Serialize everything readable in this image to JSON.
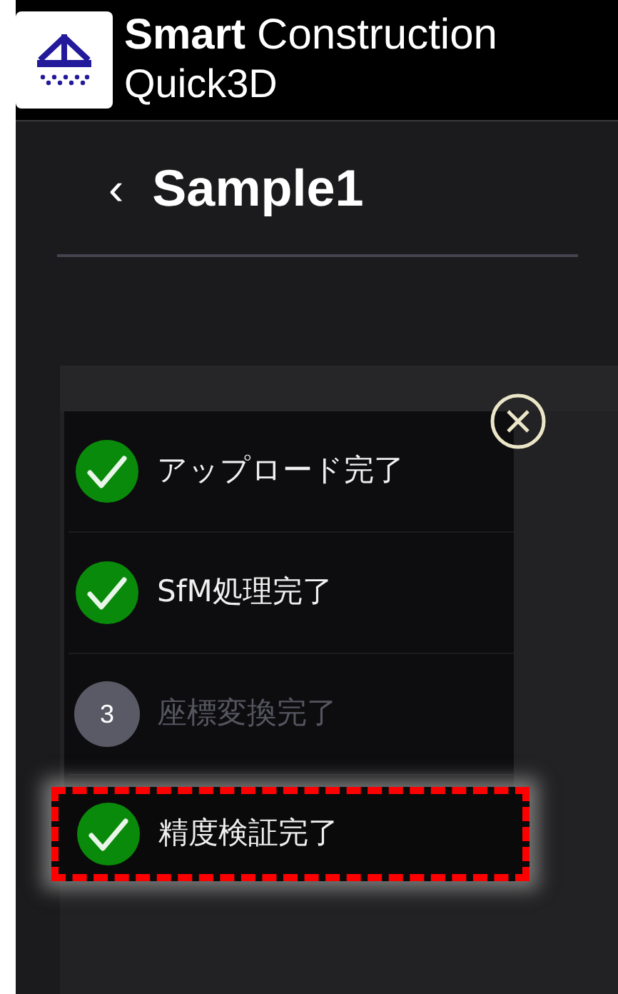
{
  "header": {
    "brand_bold": "Smart",
    "brand_rest": "Construction",
    "product": "Quick3D"
  },
  "title_bar": {
    "back": "‹",
    "title": "Sample1"
  },
  "steps": [
    {
      "kind": "done",
      "label": "アップロード完了",
      "highlighted": false
    },
    {
      "kind": "done",
      "label": "SfM処理完了",
      "highlighted": false
    },
    {
      "kind": "pending",
      "number": "3",
      "label": "座標変換完了",
      "highlighted": false
    },
    {
      "kind": "done",
      "label": "精度検証完了",
      "highlighted": true
    }
  ]
}
